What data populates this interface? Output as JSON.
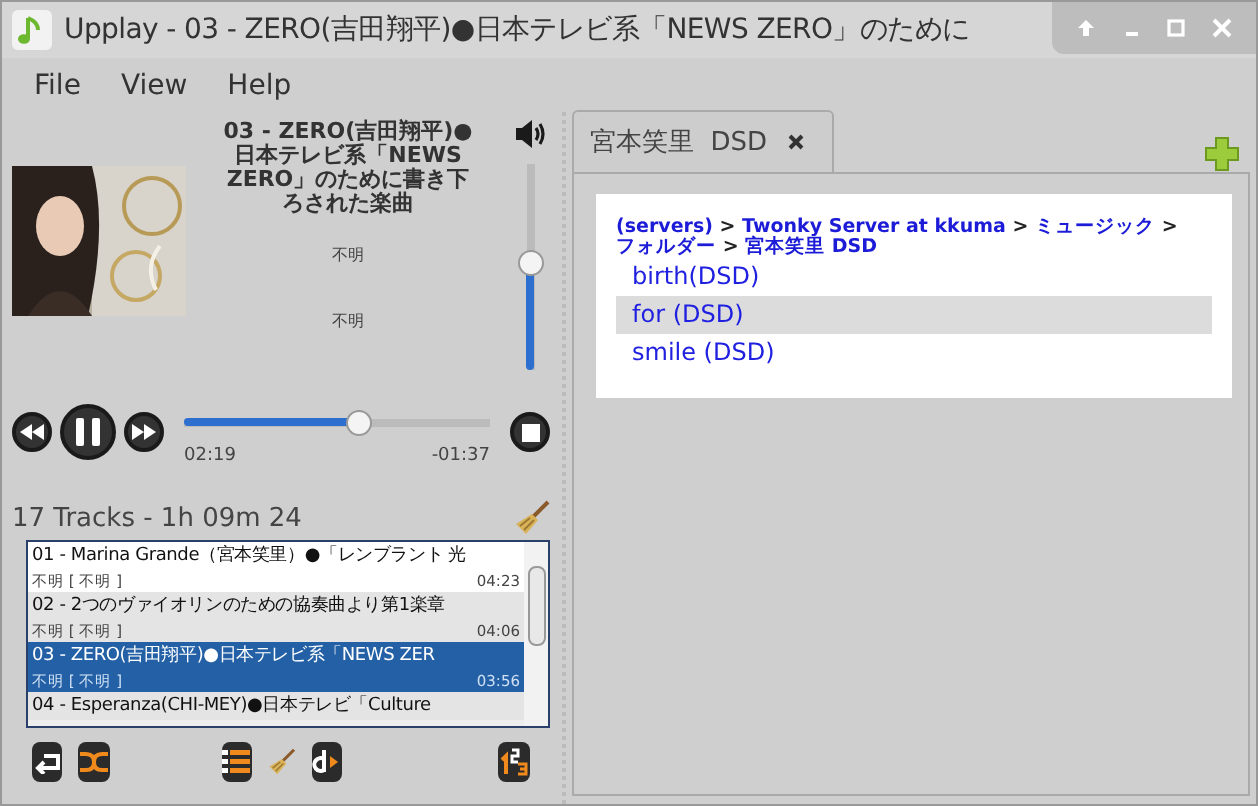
{
  "window": {
    "title": "Upplay - 03 - ZERO(吉田翔平)●日本テレビ系「NEWS ZERO」のために"
  },
  "menu": [
    "File",
    "View",
    "Help"
  ],
  "now_playing": {
    "title": "03 - ZERO(吉田翔平)●日本テレビ系「NEWS ZERO」のために書き下ろされた楽曲",
    "artist": "不明",
    "album": "不明",
    "volume": {
      "level": 0.52
    },
    "progress": {
      "level": 0.57
    },
    "elapsed": "02:19",
    "remaining": "-01:37",
    "playing": true
  },
  "playlist": {
    "summary": "17 Tracks - 1h 09m 24",
    "tracks": [
      {
        "title": "01 - Marina Grande（宮本笑里）●「レンブラント 光",
        "info": "不明 [ 不明 ]",
        "duration": "04:23",
        "selected": false
      },
      {
        "title": "02 - 2つのヴァイオリンのための協奏曲より第1楽章",
        "info": "不明 [ 不明 ]",
        "duration": "04:06",
        "selected": false
      },
      {
        "title": "03 - ZERO(吉田翔平)●日本テレビ系「NEWS ZER",
        "info": "不明 [ 不明 ]",
        "duration": "03:56",
        "selected": true
      },
      {
        "title": "04 - Esperanza(CHI-MEY)●日本テレビ「Culture",
        "selected": false
      }
    ]
  },
  "browser": {
    "tabs": [
      {
        "label": "宮本笑里  DSD",
        "selected": true
      }
    ],
    "breadcrumb": [
      {
        "kind": "link",
        "text": "(servers)"
      },
      {
        "kind": "sep",
        "text": ">"
      },
      {
        "kind": "link",
        "text": "Twonky Server at kkuma"
      },
      {
        "kind": "sep",
        "text": ">"
      },
      {
        "kind": "link",
        "text": "ミュージック"
      },
      {
        "kind": "sep",
        "text": ">"
      },
      {
        "kind": "link",
        "text": "フォルダー"
      },
      {
        "kind": "sep",
        "text": ">"
      },
      {
        "kind": "link",
        "text": "宮本笑里 DSD"
      }
    ],
    "items": [
      {
        "label": "birth(DSD)",
        "selected": false
      },
      {
        "label": "for (DSD)",
        "selected": true
      },
      {
        "label": "smile (DSD)",
        "selected": false
      }
    ]
  }
}
